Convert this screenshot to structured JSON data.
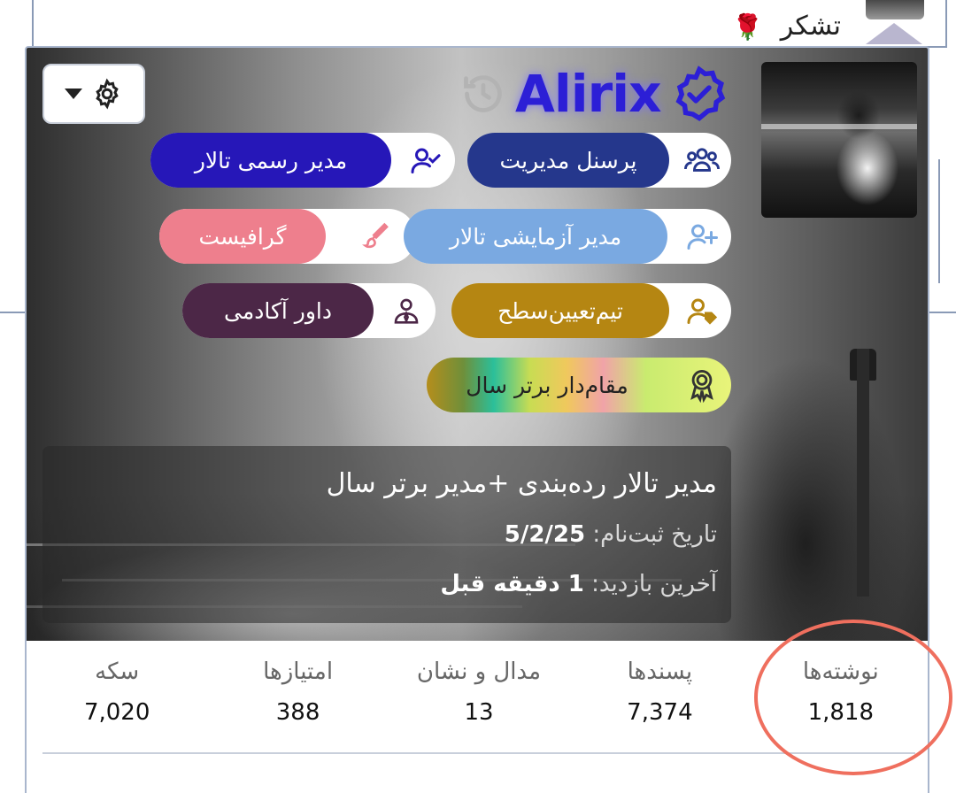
{
  "background": {
    "thanks_label": "تشکر",
    "rose_icon": "rose-icon"
  },
  "card": {
    "brand": {
      "name": "Alirix",
      "brand_color": "#2c1fd6"
    },
    "roles": [
      {
        "key": "official-admin",
        "label": "مدیر رسمی تالار",
        "icon": "user-check-icon",
        "bg": "#2617b8",
        "fg": "#ffffff",
        "iconColor": "#2617b8"
      },
      {
        "key": "staff",
        "label": "پرسنل مدیریت",
        "icon": "users-icon",
        "bg": "#25378c",
        "fg": "#ffffff",
        "iconColor": "#25378c"
      },
      {
        "key": "graphist",
        "label": "گرافیست",
        "icon": "brush-icon",
        "bg": "#ee7f8d",
        "fg": "#ffffff",
        "iconColor": "#ee7f8d"
      },
      {
        "key": "trial-admin",
        "label": "مدیر آزمایشی تالار",
        "icon": "user-plus-icon",
        "bg": "#7aa9e1",
        "fg": "#ffffff",
        "iconColor": "#7aa9e1"
      },
      {
        "key": "academy-judge",
        "label": "داور آکادمی",
        "icon": "user-tie-icon",
        "bg": "#4c2747",
        "fg": "#ffffff",
        "iconColor": "#4c2747"
      },
      {
        "key": "level-team",
        "label": "تیم‌تعیین‌سطح",
        "icon": "user-tag-icon",
        "bg": "#b58612",
        "fg": "#ffffff",
        "iconColor": "#b58612"
      },
      {
        "key": "top-rank",
        "label": "مقام‌دار برتر سال",
        "icon": "award-icon",
        "bg": "rainbow",
        "fg": "#222222",
        "iconColor": "#333333"
      }
    ],
    "info": {
      "title": "مدیر تالار رده‌بندی +مدیر برتر سال",
      "joined_label": "تاریخ ثبت‌نام:",
      "joined_value": "5/2/25",
      "last_seen_label": "آخرین بازدید:",
      "last_seen_value": "1 دقیقه قبل"
    },
    "stats": [
      {
        "label": "نوشته‌ها",
        "value": "1,818"
      },
      {
        "label": "پسندها",
        "value": "7,374"
      },
      {
        "label": "مدال و نشان",
        "value": "13"
      },
      {
        "label": "امتیازها",
        "value": "388"
      },
      {
        "label": "سکه",
        "value": "7,020"
      }
    ]
  },
  "annotation": {
    "color": "#ef6f5e"
  }
}
